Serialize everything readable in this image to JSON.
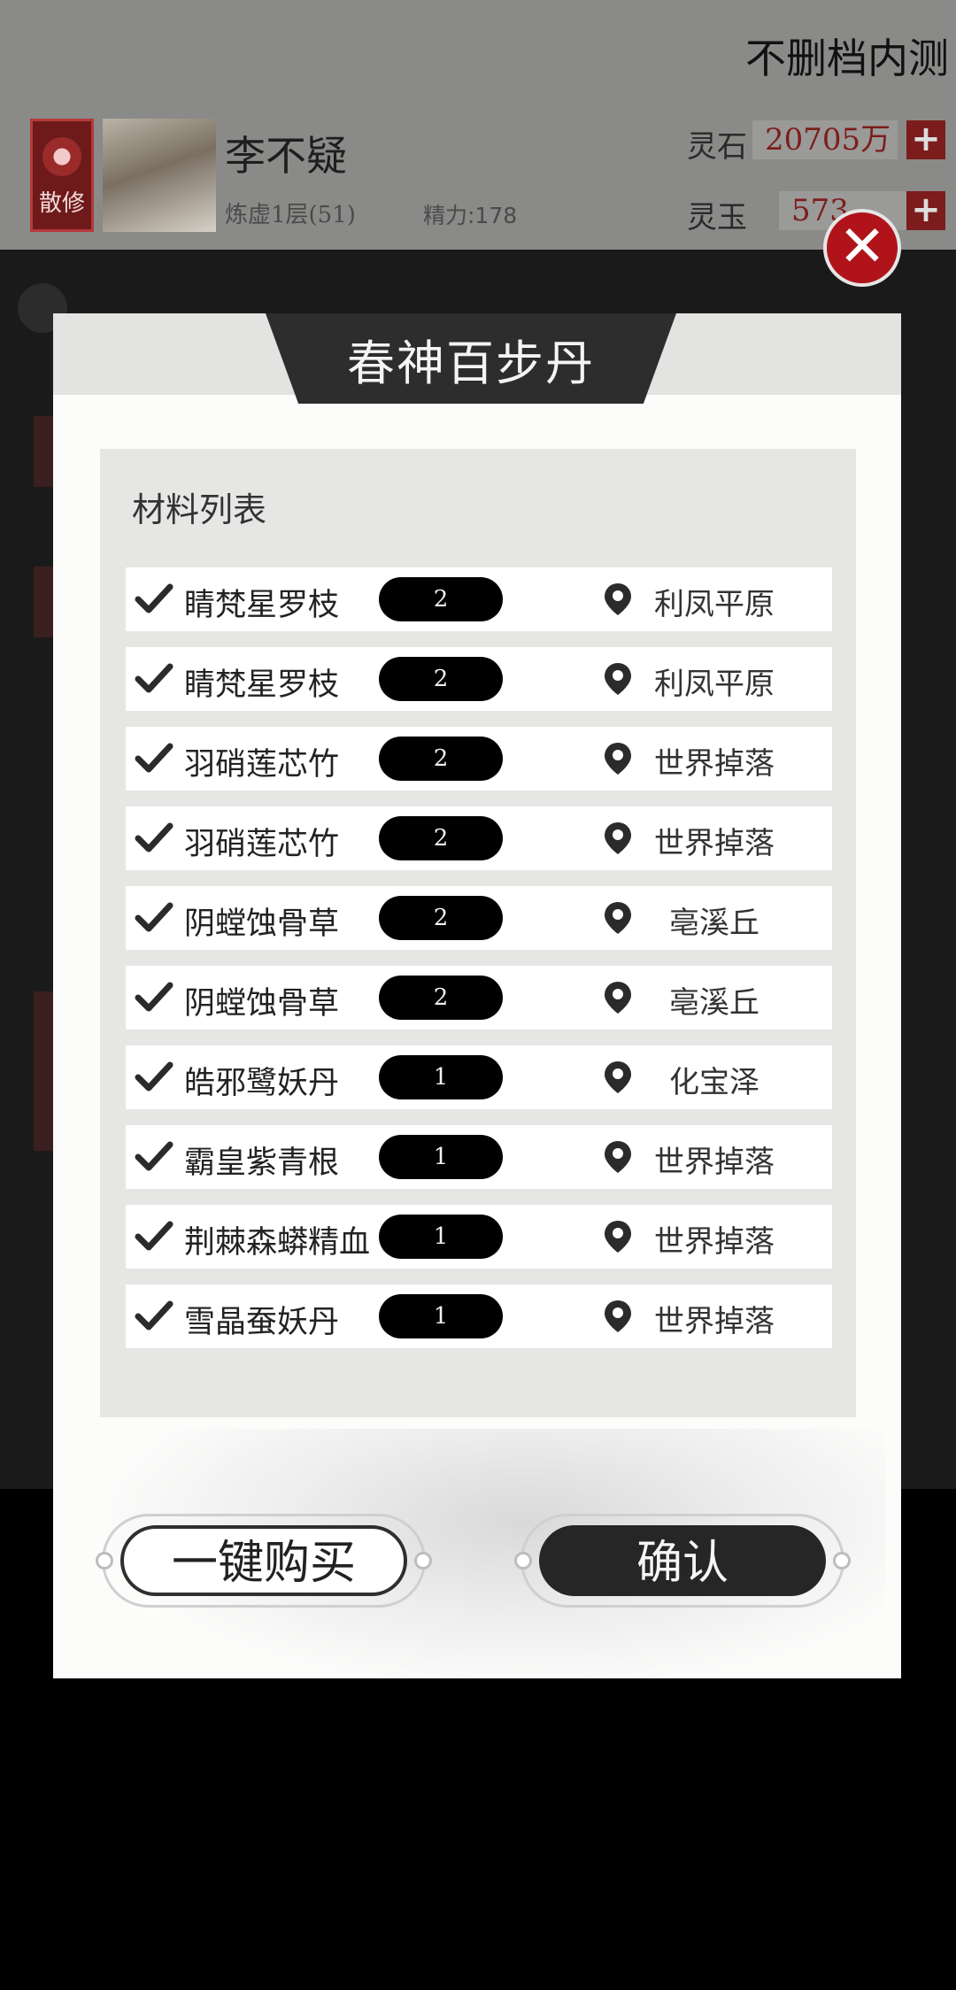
{
  "header": {
    "server_name": "不删档内测",
    "faction": "散修",
    "player_name": "李不疑",
    "realm": "炼虚1层(51)",
    "energy": "精力:178",
    "currencies": [
      {
        "label": "灵石",
        "value": "20705万"
      },
      {
        "label": "灵玉",
        "value": "573"
      }
    ]
  },
  "dialog": {
    "title": "春神百步丹",
    "panel_title": "材料列表",
    "materials": [
      {
        "name": "睛梵星罗枝",
        "qty": "2",
        "location": "利凤平原"
      },
      {
        "name": "睛梵星罗枝",
        "qty": "2",
        "location": "利凤平原"
      },
      {
        "name": "羽硝莲芯竹",
        "qty": "2",
        "location": "世界掉落"
      },
      {
        "name": "羽硝莲芯竹",
        "qty": "2",
        "location": "世界掉落"
      },
      {
        "name": "阴螳蚀骨草",
        "qty": "2",
        "location": "亳溪丘"
      },
      {
        "name": "阴螳蚀骨草",
        "qty": "2",
        "location": "亳溪丘"
      },
      {
        "name": "皓邪鹭妖丹",
        "qty": "1",
        "location": "化宝泽"
      },
      {
        "name": "霸皇紫青根",
        "qty": "1",
        "location": "世界掉落"
      },
      {
        "name": "荆棘森蟒精血",
        "qty": "1",
        "location": "世界掉落"
      },
      {
        "name": "雪晶蚕妖丹",
        "qty": "1",
        "location": "世界掉落"
      }
    ],
    "buy_all_label": "一键购买",
    "confirm_label": "确认"
  },
  "icons": {
    "check": "check-icon",
    "location": "location-pin-icon",
    "close": "close-icon"
  }
}
